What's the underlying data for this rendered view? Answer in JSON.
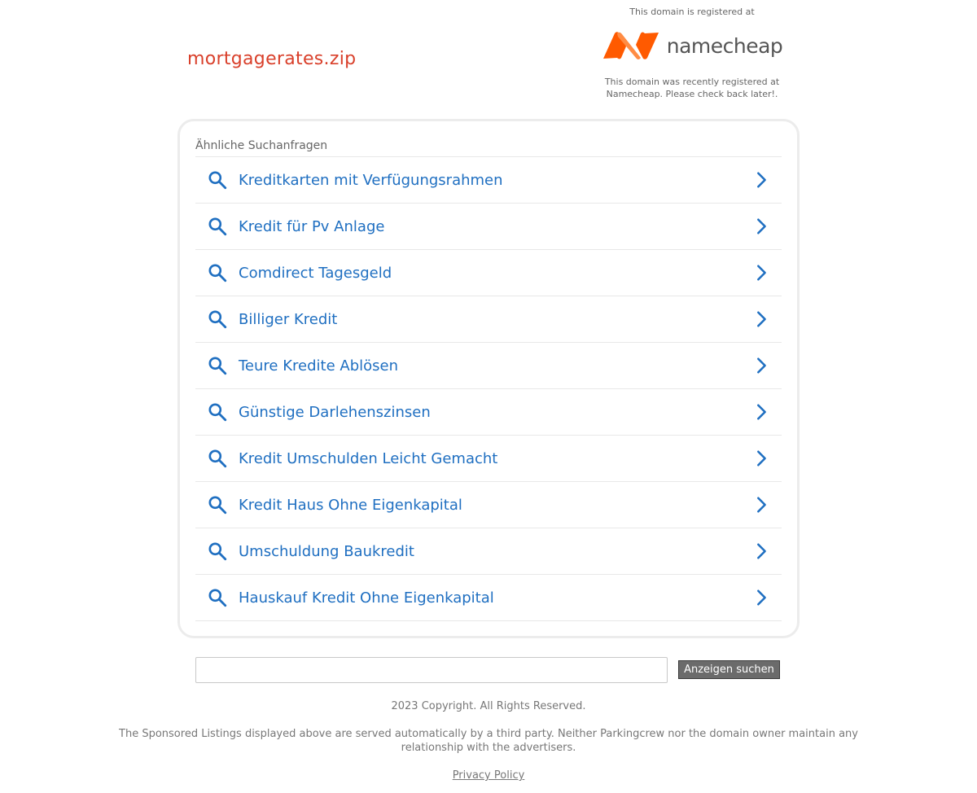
{
  "domain": {
    "name": "mortgagerates.zip",
    "color": "#d9402b"
  },
  "registrar": {
    "registered_at_text": "This domain is registered at",
    "logo_text": "namecheap",
    "logo_icon": "namecheap-logo-icon",
    "brand_colors": [
      "#ff5100",
      "#ff8c44"
    ],
    "note": "This domain was recently registered at Namecheap. Please check back later!."
  },
  "related": {
    "heading": "Ähnliche Suchanfragen",
    "link_color": "#1f6fc1",
    "items": [
      {
        "label": "Kreditkarten mit Verfügungsrahmen"
      },
      {
        "label": "Kredit für Pv Anlage"
      },
      {
        "label": "Comdirect Tagesgeld"
      },
      {
        "label": "Billiger Kredit"
      },
      {
        "label": "Teure Kredite Ablösen"
      },
      {
        "label": "Günstige Darlehenszinsen"
      },
      {
        "label": "Kredit Umschulden Leicht Gemacht"
      },
      {
        "label": "Kredit Haus Ohne Eigenkapital"
      },
      {
        "label": "Umschuldung Baukredit"
      },
      {
        "label": "Hauskauf Kredit Ohne Eigenkapital"
      }
    ],
    "item_icon": "search-icon",
    "item_arrow_icon": "chevron-right-icon"
  },
  "search": {
    "value": "",
    "placeholder": "",
    "button_label": "Anzeigen suchen"
  },
  "footer": {
    "copyright": "2023 Copyright. All Rights Reserved.",
    "disclaimer": "The Sponsored Listings displayed above are served automatically by a third party. Neither Parkingcrew nor the domain owner maintain any relationship with the advertisers.",
    "privacy_label": "Privacy Policy"
  }
}
